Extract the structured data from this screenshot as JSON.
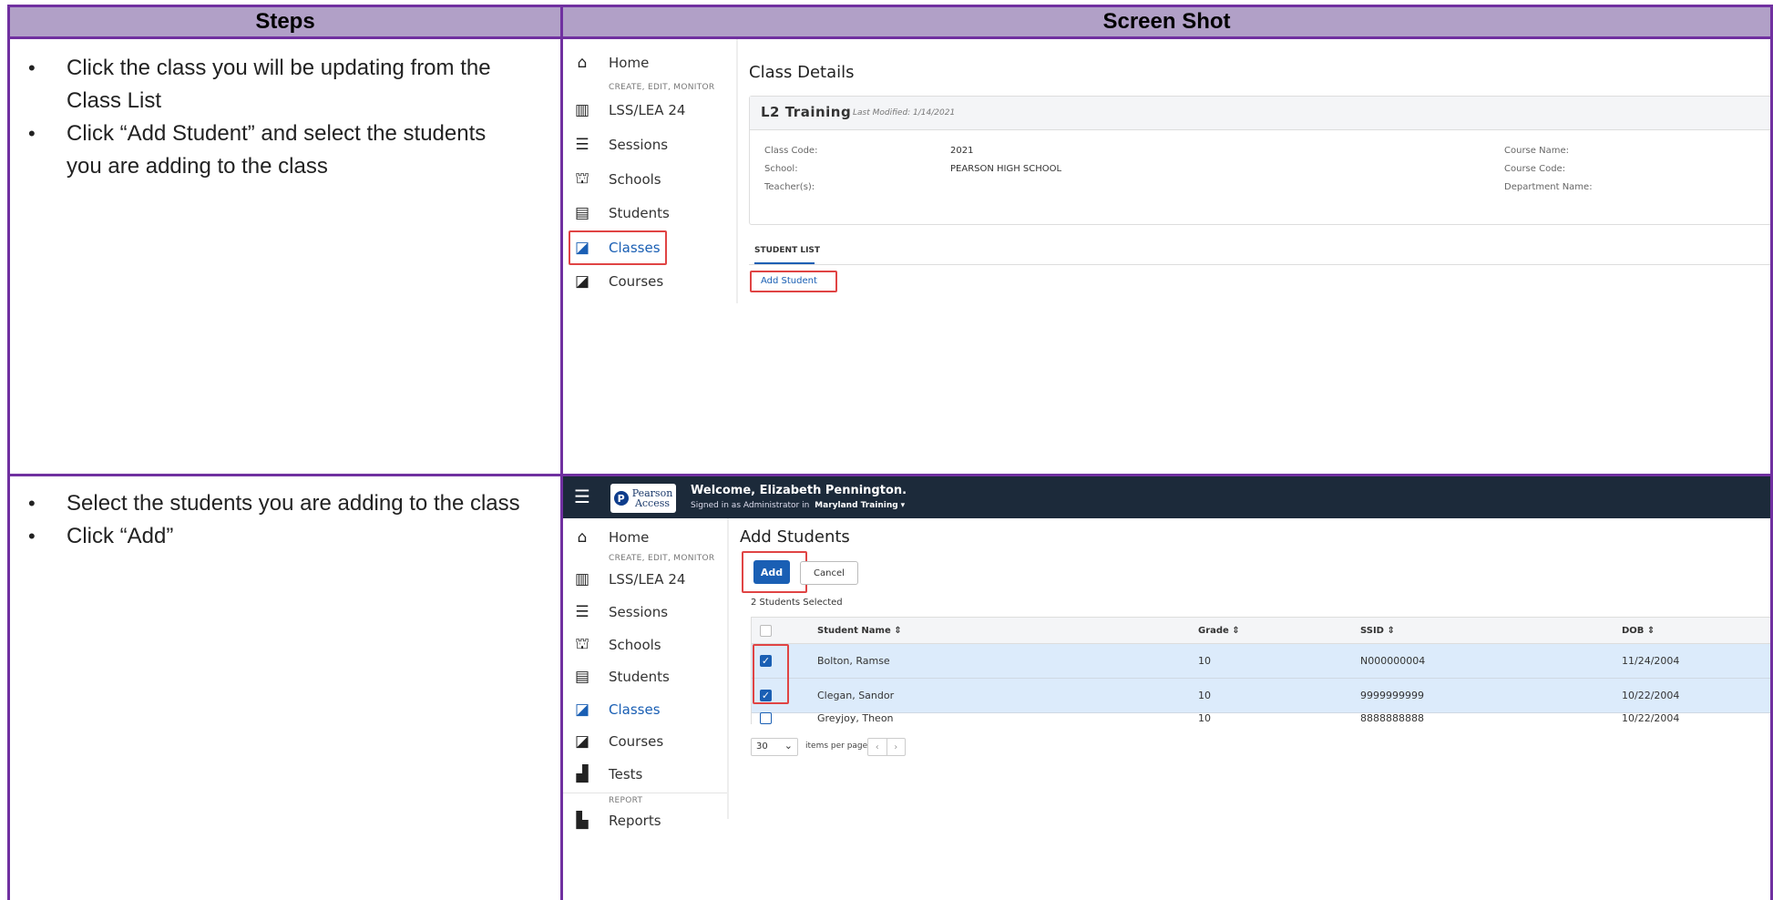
{
  "headers": {
    "steps": "Steps",
    "screenshot": "Screen Shot"
  },
  "row1": {
    "steps": [
      "Click the class you will be updating from the Class List",
      "Click “Add Student” and select the students you are adding to the class"
    ],
    "shot": {
      "nav": {
        "home": "Home",
        "section": "CREATE, EDIT, MONITOR",
        "lss": "LSS/LEA 24",
        "sessions": "Sessions",
        "schools": "Schools",
        "students": "Students",
        "classes": "Classes",
        "courses": "Courses"
      },
      "page_title": "Class Details",
      "class_name": "L2 Training",
      "last_modified": "Last Modified: 1/14/2021",
      "fields": {
        "class_code_label": "Class Code:",
        "class_code_value": "2021",
        "school_label": "School:",
        "school_value": "PEARSON HIGH SCHOOL",
        "teachers_label": "Teacher(s):",
        "course_name_label": "Course Name:",
        "course_code_label": "Course Code:",
        "department_label": "Department Name:"
      },
      "tab": "STUDENT LIST",
      "add_student": "Add Student"
    }
  },
  "row2": {
    "steps": [
      "Select the students you are adding to the class",
      "Click “Add”"
    ],
    "shot": {
      "topbar": {
        "logo_top": "Pearson",
        "logo_bottom": "Access",
        "welcome": "Welcome, Elizabeth Pennington.",
        "signed_in": "Signed in as Administrator in",
        "org": "Maryland Training"
      },
      "nav": {
        "home": "Home",
        "section": "CREATE, EDIT, MONITOR",
        "lss": "LSS/LEA 24",
        "sessions": "Sessions",
        "schools": "Schools",
        "students": "Students",
        "classes": "Classes",
        "courses": "Courses",
        "tests": "Tests",
        "report_section": "REPORT",
        "reports": "Reports"
      },
      "page_title": "Add Students",
      "add_button": "Add",
      "cancel_button": "Cancel",
      "selected_count": "2 Students Selected",
      "columns": [
        "Student Name ⇕",
        "Grade ⇕",
        "SSID ⇕",
        "DOB ⇕"
      ],
      "rows": [
        {
          "name": "Bolton, Ramse",
          "grade": "10",
          "ssid": "N000000004",
          "dob": "11/24/2004",
          "checked": true
        },
        {
          "name": "Clegan, Sandor",
          "grade": "10",
          "ssid": "9999999999",
          "dob": "10/22/2004",
          "checked": true
        },
        {
          "name": "Greyjoy, Theon",
          "grade": "10",
          "ssid": "8888888888",
          "dob": "10/22/2004",
          "checked": false
        }
      ],
      "per_page_value": "30",
      "per_page_label": "items per page"
    }
  }
}
